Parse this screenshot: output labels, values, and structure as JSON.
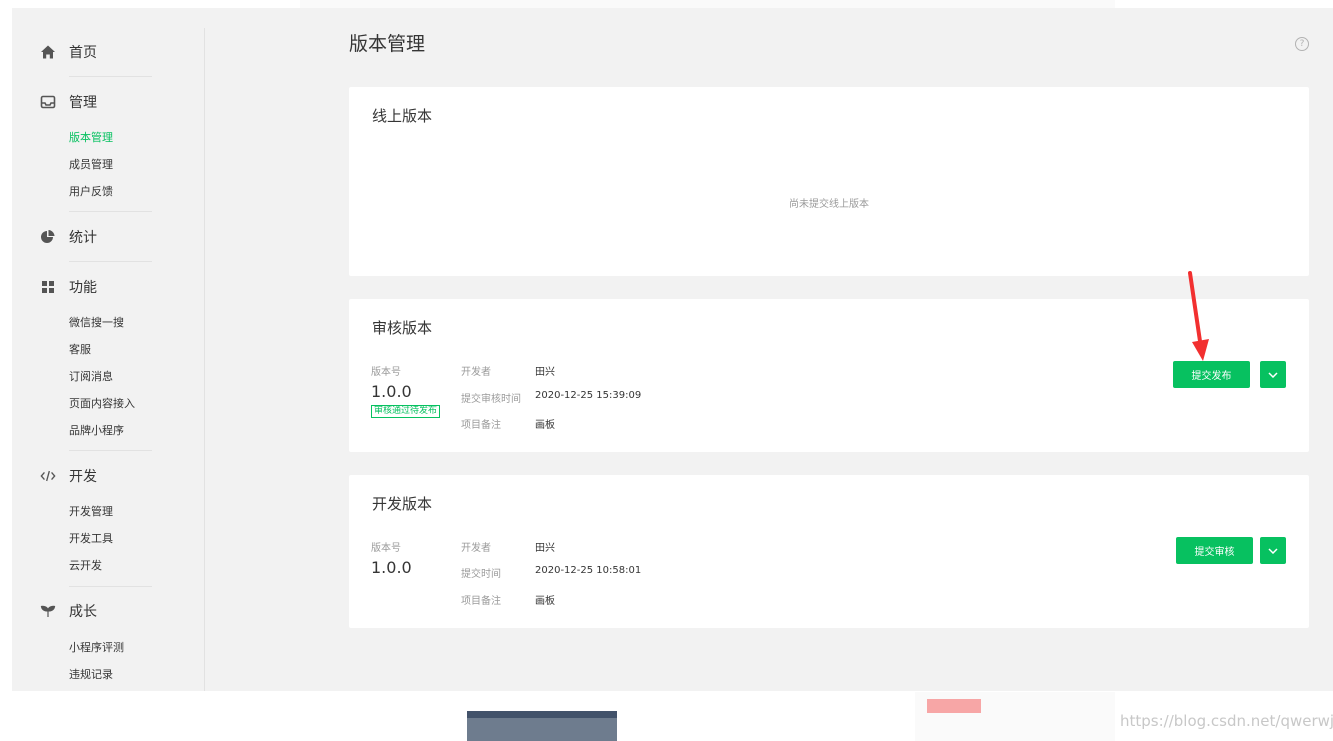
{
  "sidebar": {
    "home": {
      "label": "首页",
      "icon": "home-icon"
    },
    "manage": {
      "label": "管理",
      "icon": "inbox-icon",
      "items": [
        "版本管理",
        "成员管理",
        "用户反馈"
      ],
      "active": "版本管理"
    },
    "stats": {
      "label": "统计",
      "icon": "pie-chart-icon"
    },
    "features": {
      "label": "功能",
      "icon": "grid-icon",
      "items": [
        "微信搜一搜",
        "客服",
        "订阅消息",
        "页面内容接入",
        "品牌小程序"
      ]
    },
    "dev": {
      "label": "开发",
      "icon": "code-icon",
      "items": [
        "开发管理",
        "开发工具",
        "云开发"
      ]
    },
    "growth": {
      "label": "成长",
      "icon": "sprout-icon",
      "items": [
        "小程序评测",
        "违规记录"
      ]
    }
  },
  "page": {
    "title": "版本管理",
    "help_icon": "help-icon",
    "help_glyph": "?"
  },
  "online": {
    "title": "线上版本",
    "empty": "尚未提交线上版本"
  },
  "review": {
    "title": "审核版本",
    "version_label": "版本号",
    "version": "1.0.0",
    "status": "审核通过待发布",
    "meta": [
      {
        "k": "开发者",
        "v": "田兴"
      },
      {
        "k": "提交审核时间",
        "v": "2020-12-25 15:39:09"
      },
      {
        "k": "项目备注",
        "v": "画板"
      }
    ],
    "button": "提交发布"
  },
  "develop": {
    "title": "开发版本",
    "version_label": "版本号",
    "version": "1.0.0",
    "meta": [
      {
        "k": "开发者",
        "v": "田兴"
      },
      {
        "k": "提交时间",
        "v": "2020-12-25 10:58:01"
      },
      {
        "k": "项目备注",
        "v": "画板"
      }
    ],
    "button": "提交审核"
  },
  "watermark": "https://blog.csdn.net/qwerwjs",
  "colors": {
    "accent": "#07c160",
    "annotation": "#f23030"
  }
}
